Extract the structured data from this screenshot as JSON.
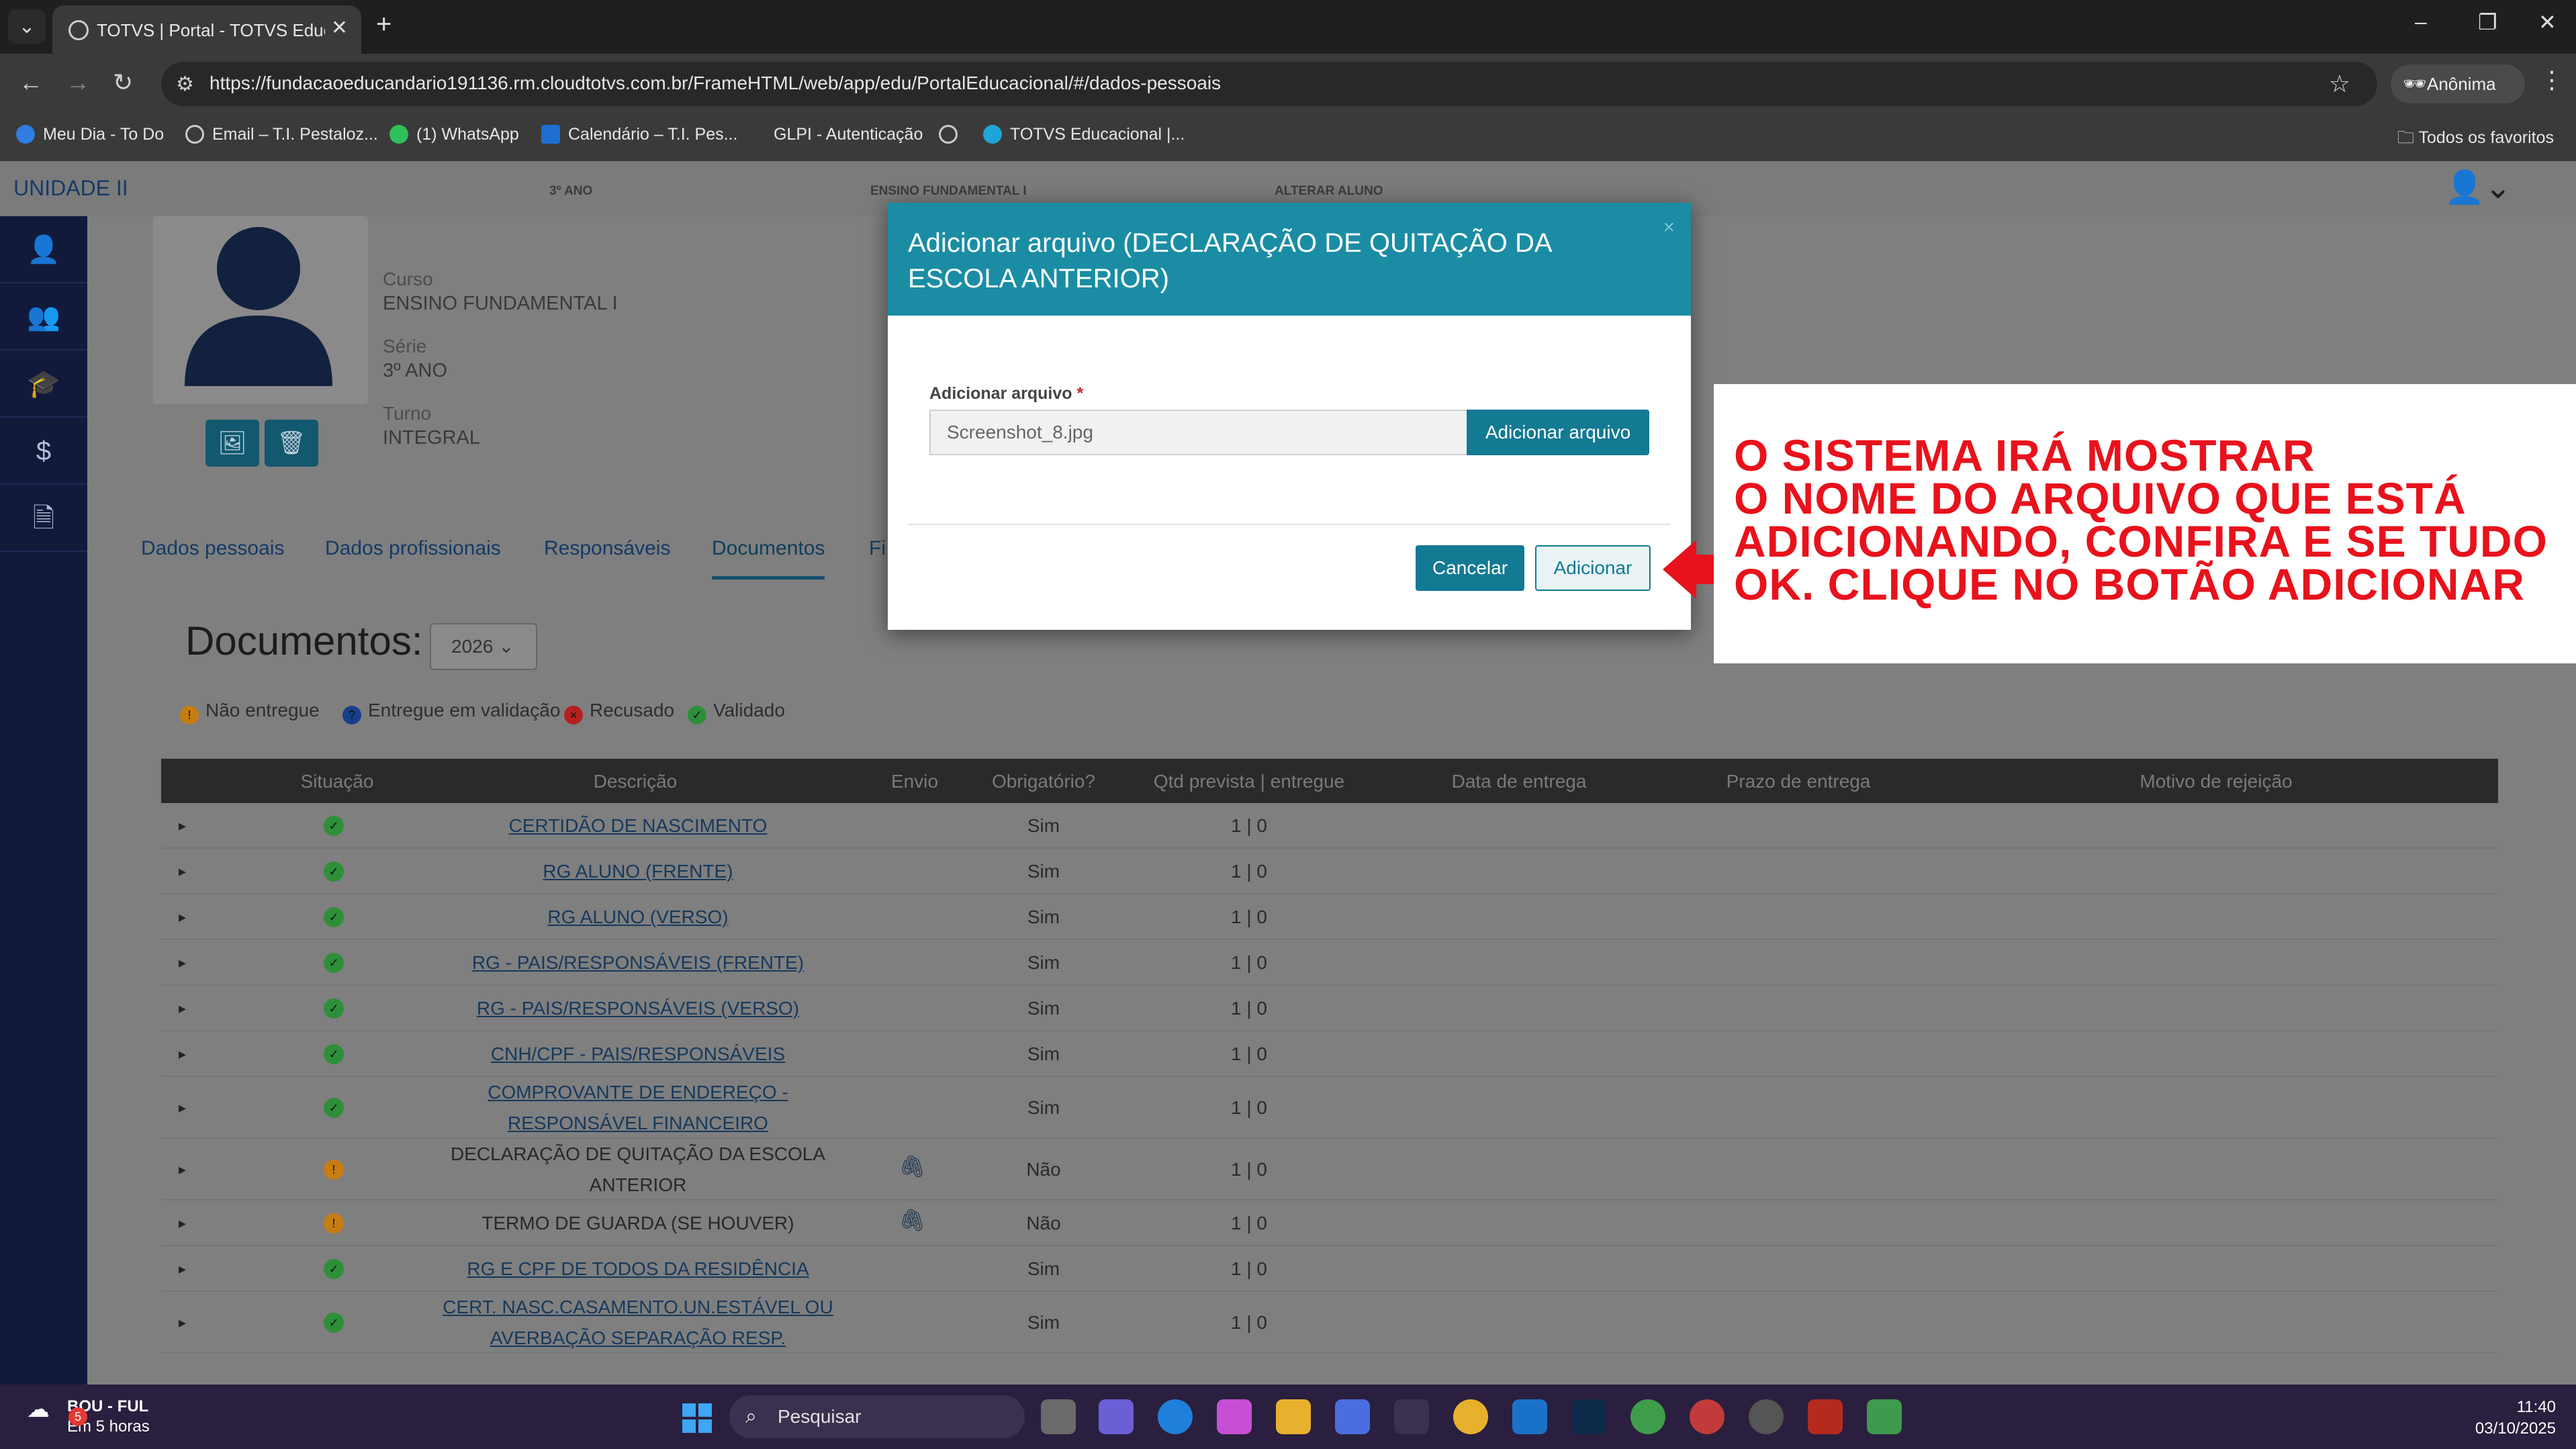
{
  "browser": {
    "tab_title": "TOTVS | Portal - TOTVS Educacional",
    "url": "https://fundacaoeducandario191136.rm.cloudtotvs.com.br/FrameHTML/web/app/edu/PortalEducacional/#/dados-pessoais",
    "incognito_label": "Anônima",
    "bookmarks": [
      "Meu Dia - To Do",
      "Email – T.I. Pestaloz...",
      "(1) WhatsApp",
      "Calendário – T.I. Pes...",
      "GLPI - Autenticação",
      "TOTVS Educacional |..."
    ],
    "bookmarks_folder": "Todos os favoritos"
  },
  "portal": {
    "unit": "UNIDADE II",
    "top_year": "3º ANO",
    "top_level": "ENSINO FUNDAMENTAL I",
    "top_action": "ALTERAR ALUNO",
    "student": {
      "course_label": "Curso",
      "course": "ENSINO FUNDAMENTAL I",
      "grade_label": "Série",
      "grade": "3º ANO",
      "shift_label": "Turno",
      "shift": "INTEGRAL"
    },
    "tabs": [
      "Dados pessoais",
      "Dados profissionais",
      "Responsáveis",
      "Documentos",
      "Fi"
    ],
    "active_tab": "Documentos",
    "documents_title": "Documentos:",
    "year": "2026",
    "legend": [
      {
        "label": "Não entregue",
        "color": "#c77d14",
        "glyph": "!"
      },
      {
        "label": "Entregue em validação",
        "color": "#1a3f8a",
        "glyph": "?"
      },
      {
        "label": "Recusado",
        "color": "#b51f1f",
        "glyph": "×"
      },
      {
        "label": "Validado",
        "color": "#2e8f3a",
        "glyph": "✓"
      }
    ],
    "table": {
      "headers": [
        "Situação",
        "Descrição",
        "Envio",
        "Obrigatório?",
        "Qtd prevista | entregue",
        "Data de entrega",
        "Prazo de entrega",
        "Motivo de rejeição"
      ],
      "rows": [
        {
          "status": "validado",
          "desc1": "CERTIDÃO DE NASCIMENTO",
          "desc2": "",
          "link": true,
          "clip": false,
          "required": "Sim",
          "qty": "1 | 0"
        },
        {
          "status": "validado",
          "desc1": "RG ALUNO (FRENTE)",
          "desc2": "",
          "link": true,
          "clip": false,
          "required": "Sim",
          "qty": "1 | 0"
        },
        {
          "status": "validado",
          "desc1": "RG ALUNO (VERSO)",
          "desc2": "",
          "link": true,
          "clip": false,
          "required": "Sim",
          "qty": "1 | 0"
        },
        {
          "status": "validado",
          "desc1": "RG - PAIS/RESPONSÁVEIS (FRENTE)",
          "desc2": "",
          "link": true,
          "clip": false,
          "required": "Sim",
          "qty": "1 | 0"
        },
        {
          "status": "validado",
          "desc1": "RG - PAIS/RESPONSÁVEIS (VERSO)",
          "desc2": "",
          "link": true,
          "clip": false,
          "required": "Sim",
          "qty": "1 | 0"
        },
        {
          "status": "validado",
          "desc1": "CNH/CPF - PAIS/RESPONSÁVEIS",
          "desc2": "",
          "link": true,
          "clip": false,
          "required": "Sim",
          "qty": "1 | 0"
        },
        {
          "status": "validado",
          "desc1": "COMPROVANTE DE ENDEREÇO -",
          "desc2": "RESPONSÁVEL FINANCEIRO",
          "link": true,
          "clip": false,
          "required": "Sim",
          "qty": "1 | 0"
        },
        {
          "status": "nao",
          "desc1": "DECLARAÇÃO DE QUITAÇÃO DA ESCOLA",
          "desc2": "ANTERIOR",
          "link": false,
          "clip": true,
          "required": "Não",
          "qty": "1 | 0"
        },
        {
          "status": "nao",
          "desc1": "TERMO DE GUARDA (SE HOUVER)",
          "desc2": "",
          "link": false,
          "clip": true,
          "required": "Não",
          "qty": "1 | 0"
        },
        {
          "status": "validado",
          "desc1": "RG E CPF DE TODOS DA RESIDÊNCIA",
          "desc2": "",
          "link": true,
          "clip": false,
          "required": "Sim",
          "qty": "1 | 0"
        },
        {
          "status": "validado",
          "desc1": "CERT. NASC.CASAMENTO.UN.ESTÁVEL OU",
          "desc2": "AVERBAÇÃO SEPARAÇÃO RESP.",
          "link": true,
          "clip": false,
          "required": "Sim",
          "qty": "1 | 0"
        }
      ]
    }
  },
  "modal": {
    "title": "Adicionar arquivo (DECLARAÇÃO DE QUITAÇÃO DA ESCOLA ANTERIOR)",
    "field_label": "Adicionar arquivo",
    "required_mark": "*",
    "file_name": "Screenshot_8.jpg",
    "browse_button": "Adicionar arquivo",
    "cancel_button": "Cancelar",
    "add_button": "Adicionar"
  },
  "annotation": {
    "text": "O SISTEMA IRÁ MOSTRAR\nO NOME DO ARQUIVO QUE ESTÁ\nADICIONANDO, CONFIRA E SE TUDO\nOK. CLIQUE NO BOTÃO ADICIONAR",
    "color": "#e8121c"
  },
  "taskbar": {
    "weather_title": "BOU - FUL",
    "weather_sub": "Em 5 horas",
    "weather_badge": "5",
    "search_label": "Pesquisar",
    "time": "11:40",
    "date": "03/10/2025"
  }
}
